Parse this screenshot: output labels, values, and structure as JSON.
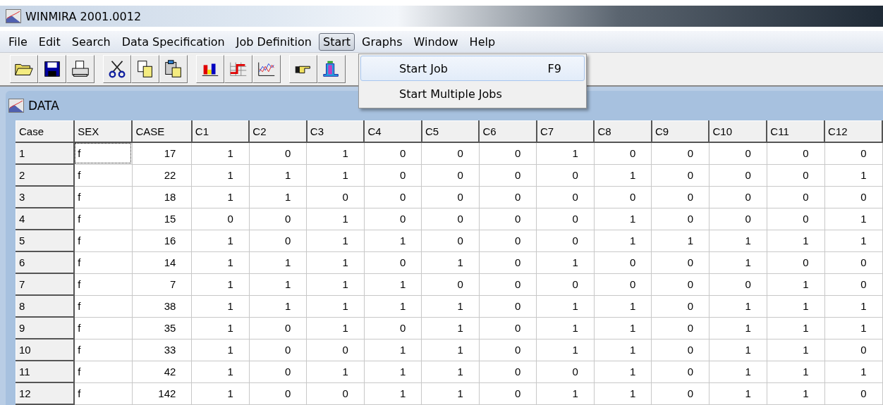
{
  "window": {
    "title": "WINMIRA 2001.0012"
  },
  "menu_bar": [
    {
      "label": "File",
      "selected": false
    },
    {
      "label": "Edit",
      "selected": false
    },
    {
      "label": "Search",
      "selected": false
    },
    {
      "label": "Data Specification",
      "selected": false
    },
    {
      "label": "Job Definition",
      "selected": false
    },
    {
      "label": "Start",
      "selected": true
    },
    {
      "label": "Graphs",
      "selected": false
    },
    {
      "label": "Window",
      "selected": false
    },
    {
      "label": "Help",
      "selected": false
    }
  ],
  "start_menu": [
    {
      "label": "Start Job",
      "shortcut": "F9",
      "selected": true
    },
    {
      "label": "Start Multiple Jobs",
      "selected": false
    }
  ],
  "data_window": {
    "title": "DATA",
    "columns": [
      "Case",
      "SEX",
      "CASE",
      "C1",
      "C2",
      "C3",
      "C4",
      "C5",
      "C6",
      "C7",
      "C8",
      "C9",
      "C10",
      "C11",
      "C12"
    ],
    "rows": [
      {
        "cells": [
          "1",
          "f",
          "17",
          "1",
          "0",
          "1",
          "0",
          "0",
          "0",
          "1",
          "0",
          "0",
          "0",
          "0",
          "0"
        ],
        "sex_focused": true
      },
      {
        "cells": [
          "2",
          "f",
          "22",
          "1",
          "1",
          "1",
          "0",
          "0",
          "0",
          "0",
          "1",
          "0",
          "0",
          "0",
          "1"
        ],
        "sex_focused": false
      },
      {
        "cells": [
          "3",
          "f",
          "18",
          "1",
          "1",
          "0",
          "0",
          "0",
          "0",
          "0",
          "0",
          "0",
          "0",
          "0",
          "0"
        ],
        "sex_focused": false
      },
      {
        "cells": [
          "4",
          "f",
          "15",
          "0",
          "0",
          "1",
          "0",
          "0",
          "0",
          "0",
          "1",
          "0",
          "0",
          "0",
          "1"
        ],
        "sex_focused": false
      },
      {
        "cells": [
          "5",
          "f",
          "16",
          "1",
          "0",
          "1",
          "1",
          "0",
          "0",
          "0",
          "1",
          "1",
          "1",
          "1",
          "1"
        ],
        "sex_focused": false
      },
      {
        "cells": [
          "6",
          "f",
          "14",
          "1",
          "1",
          "1",
          "0",
          "1",
          "0",
          "1",
          "0",
          "0",
          "1",
          "0",
          "0"
        ],
        "sex_focused": false
      },
      {
        "cells": [
          "7",
          "f",
          "7",
          "1",
          "1",
          "1",
          "1",
          "0",
          "0",
          "0",
          "0",
          "0",
          "0",
          "1",
          "0"
        ],
        "sex_focused": false
      },
      {
        "cells": [
          "8",
          "f",
          "38",
          "1",
          "1",
          "1",
          "1",
          "1",
          "0",
          "1",
          "1",
          "0",
          "1",
          "1",
          "1"
        ],
        "sex_focused": false
      },
      {
        "cells": [
          "9",
          "f",
          "35",
          "1",
          "0",
          "1",
          "0",
          "1",
          "0",
          "1",
          "1",
          "0",
          "1",
          "1",
          "1"
        ],
        "sex_focused": false
      },
      {
        "cells": [
          "10",
          "f",
          "33",
          "1",
          "0",
          "0",
          "1",
          "1",
          "0",
          "1",
          "1",
          "0",
          "1",
          "1",
          "0"
        ],
        "sex_focused": false
      },
      {
        "cells": [
          "11",
          "f",
          "42",
          "1",
          "0",
          "1",
          "1",
          "1",
          "0",
          "0",
          "1",
          "0",
          "1",
          "1",
          "1"
        ],
        "sex_focused": false
      },
      {
        "cells": [
          "12",
          "f",
          "142",
          "1",
          "0",
          "0",
          "1",
          "1",
          "0",
          "1",
          "1",
          "0",
          "1",
          "1",
          "0"
        ],
        "sex_focused": false
      }
    ]
  }
}
